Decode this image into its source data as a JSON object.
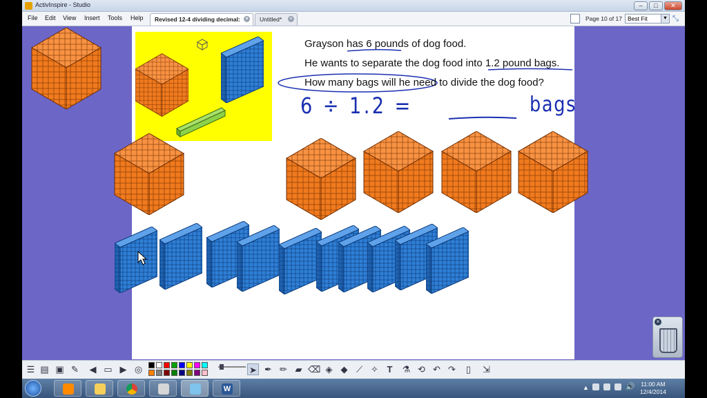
{
  "window": {
    "title": "ActivInspire - Studio",
    "controls": [
      "minimize",
      "maximize",
      "close"
    ]
  },
  "menu": {
    "items": [
      "File",
      "Edit",
      "View",
      "Insert",
      "Tools",
      "Help"
    ]
  },
  "tabs": [
    {
      "label": "Revised 12-4 dividing decimal:",
      "active": true
    },
    {
      "label": "Untitled*",
      "active": false
    }
  ],
  "nav": {
    "page_label": "Page 10 of 17",
    "zoom_value": "Best Fit"
  },
  "flipchart": {
    "lines": [
      {
        "before": "Grayson has ",
        "underlined": "6 pounds",
        "after": " of dog food."
      },
      {
        "before": "He wants to separate the dog food into ",
        "underlined": "1.2 pound bags",
        "after": "."
      },
      {
        "circled": "How many bags will he need",
        "after": " to divide the dog food?"
      }
    ],
    "handwriting": {
      "expression": "6 ÷ 1.2 =",
      "answer_blank": "______",
      "unit": "bags"
    },
    "blocks": {
      "cube_color": "#f07a1e",
      "flat_color": "#2f7fd6",
      "rod_color": "#8ed14b",
      "panel_color": "#ffff00",
      "background_color": "#6c66c7"
    }
  },
  "toolbar": {
    "colors": [
      "#000000",
      "#ffffff",
      "#ff0000",
      "#00a000",
      "#0000ff",
      "#ffff00",
      "#ff00ff",
      "#00ffff",
      "#ff8000",
      "#808080",
      "#800000",
      "#008000",
      "#000080",
      "#808000",
      "#800080",
      "#ffc0cb"
    ],
    "tools": [
      "select",
      "pen",
      "highlighter",
      "eraser",
      "fill",
      "shape",
      "connector",
      "text",
      "clear",
      "undo",
      "redo"
    ]
  },
  "taskbar": {
    "apps": [
      "start",
      "media-player",
      "file-explorer",
      "chrome",
      "activinspire",
      "paint",
      "word"
    ],
    "time": "11:00 AM",
    "date": "12/4/2014"
  }
}
